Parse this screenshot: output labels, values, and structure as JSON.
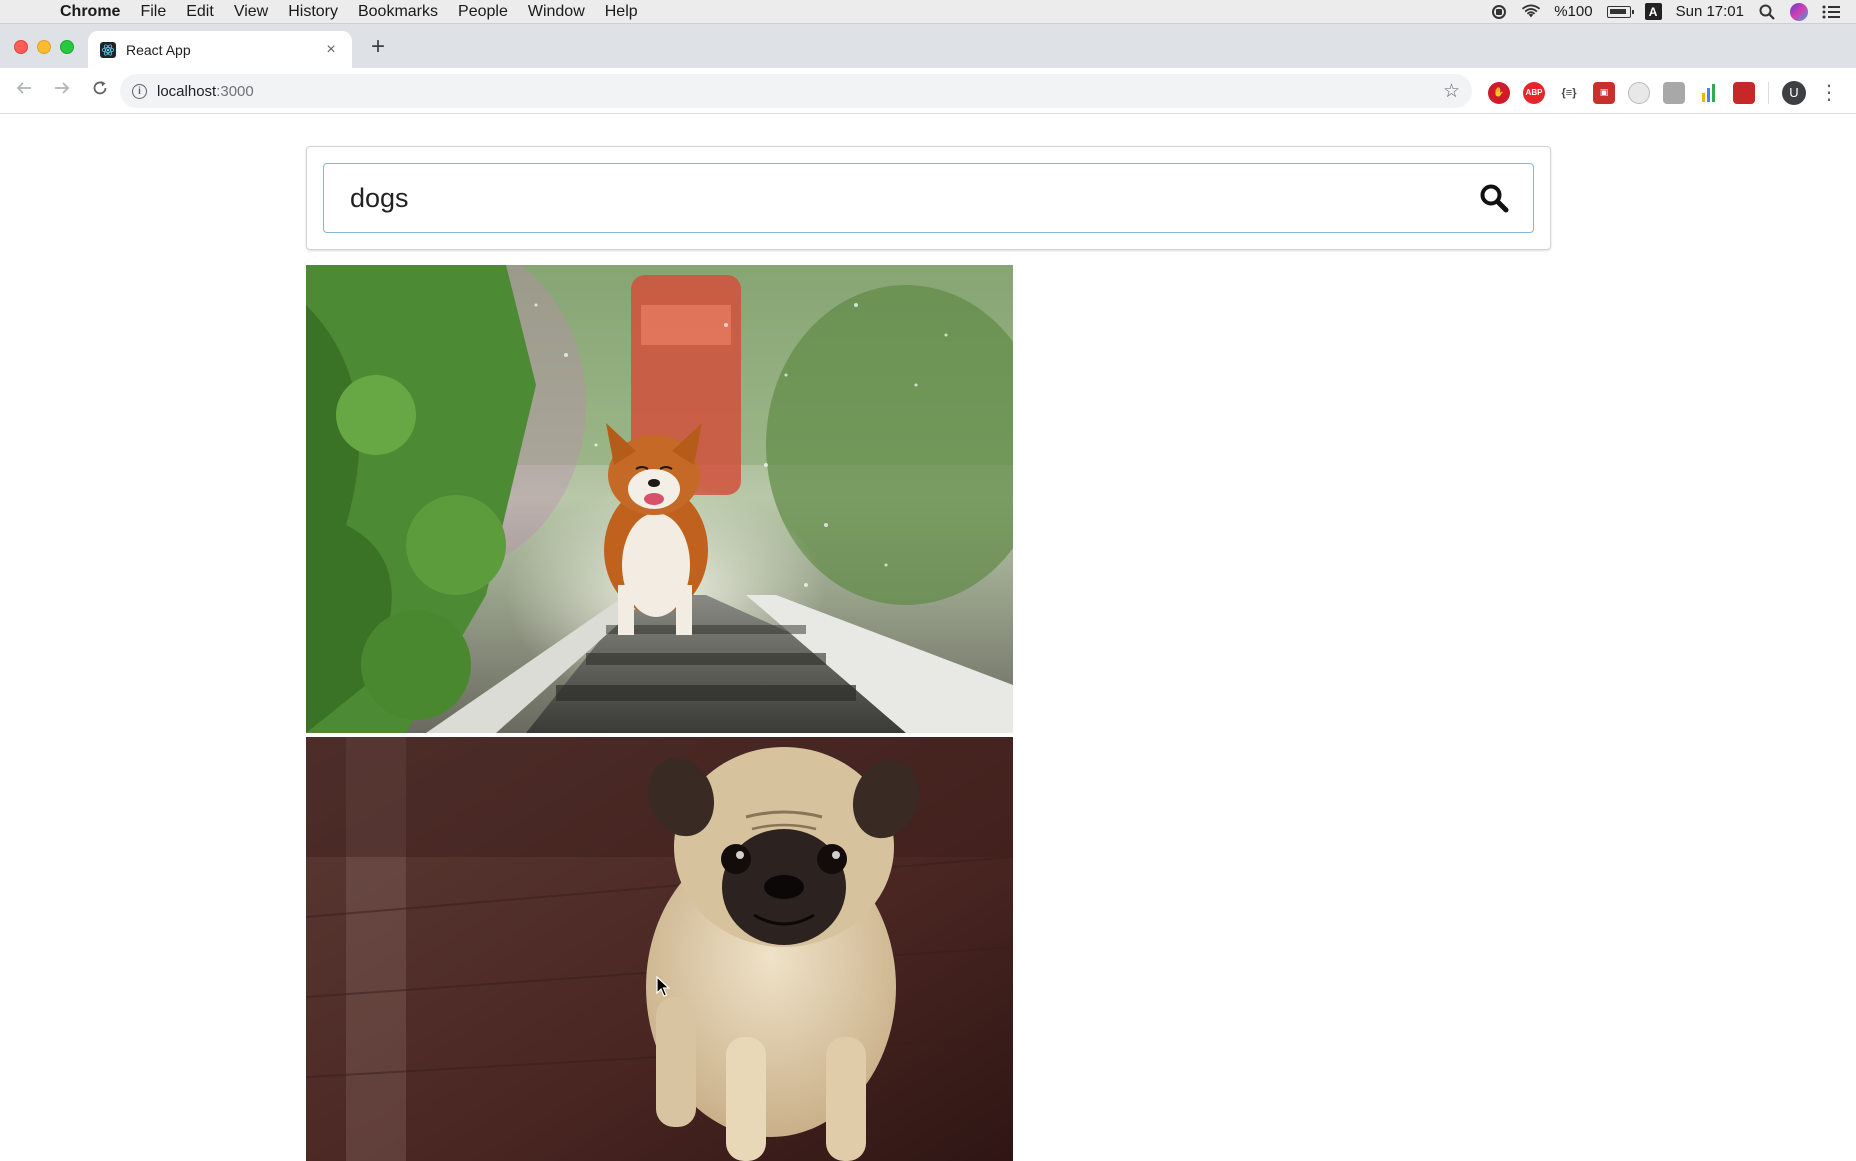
{
  "menubar": {
    "app_name": "Chrome",
    "items": [
      "File",
      "Edit",
      "View",
      "History",
      "Bookmarks",
      "People",
      "Window",
      "Help"
    ],
    "battery_text": "%100",
    "input_source": "A",
    "clock": "Sun 17:01"
  },
  "tab": {
    "title": "React App",
    "close_glyph": "×",
    "new_tab_glyph": "+"
  },
  "omnibox": {
    "host": "localhost",
    "port": ":3000"
  },
  "extensions": [
    "ABP",
    "{≡}"
  ],
  "profile_initial": "U",
  "search": {
    "value": "dogs"
  },
  "images": [
    {
      "subject": "corgi on railway tracks"
    },
    {
      "subject": "pug puppy on wooden floor"
    }
  ],
  "colors": {
    "accent": "#85b7d9",
    "tab_strip": "#dee1e6",
    "omnibox_bg": "#f1f3f4"
  }
}
